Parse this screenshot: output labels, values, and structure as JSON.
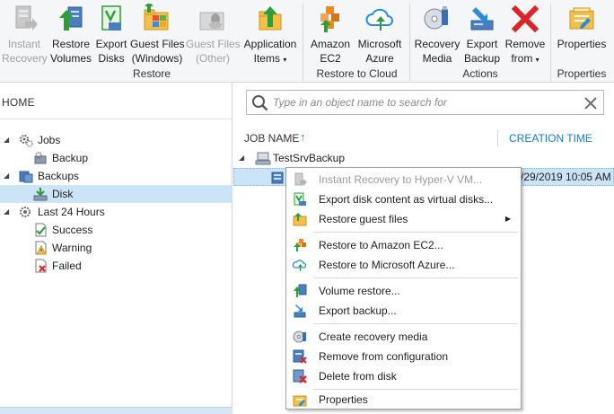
{
  "ribbon": {
    "buttons": [
      {
        "label1": "Instant",
        "label2": "Recovery",
        "icon": "instant-recovery-icon",
        "enabled": false
      },
      {
        "label1": "Restore",
        "label2": "Volumes",
        "icon": "restore-volumes-icon",
        "enabled": true
      },
      {
        "label1": "Export",
        "label2": "Disks",
        "icon": "export-disks-icon",
        "enabled": true
      },
      {
        "label1": "Guest Files",
        "label2": "(Windows)",
        "icon": "guest-files-windows-icon",
        "enabled": true
      },
      {
        "label1": "Guest Files",
        "label2": "(Other)",
        "icon": "guest-files-other-icon",
        "enabled": false
      },
      {
        "label1": "Application",
        "label2": "Items",
        "icon": "application-items-icon",
        "enabled": true,
        "dropdown": true
      },
      {
        "label1": "Amazon",
        "label2": "EC2",
        "icon": "amazon-ec2-icon",
        "enabled": true
      },
      {
        "label1": "Microsoft",
        "label2": "Azure",
        "icon": "microsoft-azure-icon",
        "enabled": true
      },
      {
        "label1": "Recovery",
        "label2": "Media",
        "icon": "recovery-media-icon",
        "enabled": true
      },
      {
        "label1": "Export",
        "label2": "Backup",
        "icon": "export-backup-icon",
        "enabled": true
      },
      {
        "label1": "Remove",
        "label2": "from",
        "icon": "remove-from-icon",
        "enabled": true,
        "dropdown": true
      },
      {
        "label1": "Properties",
        "label2": "",
        "icon": "properties-icon",
        "enabled": true
      }
    ],
    "groups": {
      "restore": "Restore",
      "restore_to_cloud": "Restore to Cloud",
      "actions": "Actions",
      "properties": "Properties"
    }
  },
  "nav": {
    "home": "HOME",
    "jobs": "Jobs",
    "backup": "Backup",
    "backups": "Backups",
    "disk": "Disk",
    "last24": "Last 24 Hours",
    "success": "Success",
    "warning": "Warning",
    "failed": "Failed"
  },
  "search": {
    "placeholder": "Type in an object name to search for"
  },
  "table": {
    "col_job_name": "JOB NAME",
    "sort_arrow": "↑",
    "col_creation_time": "CREATION TIME",
    "job_name": "TestSrvBackup",
    "disk_date": "/29/2019 10:05 AM"
  },
  "context_menu": {
    "items": [
      {
        "label": "Instant Recovery to Hyper-V VM...",
        "icon": "instant-recovery-icon",
        "disabled": true
      },
      {
        "label": "Export disk content as virtual disks...",
        "icon": "export-disks-icon"
      },
      {
        "label": "Restore guest files",
        "icon": "restore-guest-files-icon",
        "submenu": true
      },
      {
        "label": "Restore to Amazon EC2...",
        "icon": "amazon-ec2-icon"
      },
      {
        "label": "Restore to Microsoft Azure...",
        "icon": "microsoft-azure-icon"
      },
      {
        "label": "Volume restore...",
        "icon": "volume-restore-icon"
      },
      {
        "label": "Export backup...",
        "icon": "export-backup-icon"
      },
      {
        "label": "Create recovery media",
        "icon": "recovery-media-icon"
      },
      {
        "label": "Remove from configuration",
        "icon": "remove-from-configuration-icon"
      },
      {
        "label": "Delete from disk",
        "icon": "delete-from-disk-icon"
      },
      {
        "label": "Properties",
        "icon": "properties-icon"
      }
    ]
  },
  "colors": {
    "accent": "#1b78c7",
    "selection": "#cce4f7",
    "green": "#2e9e3a",
    "red": "#d9262a",
    "orange": "#f08a1c"
  }
}
